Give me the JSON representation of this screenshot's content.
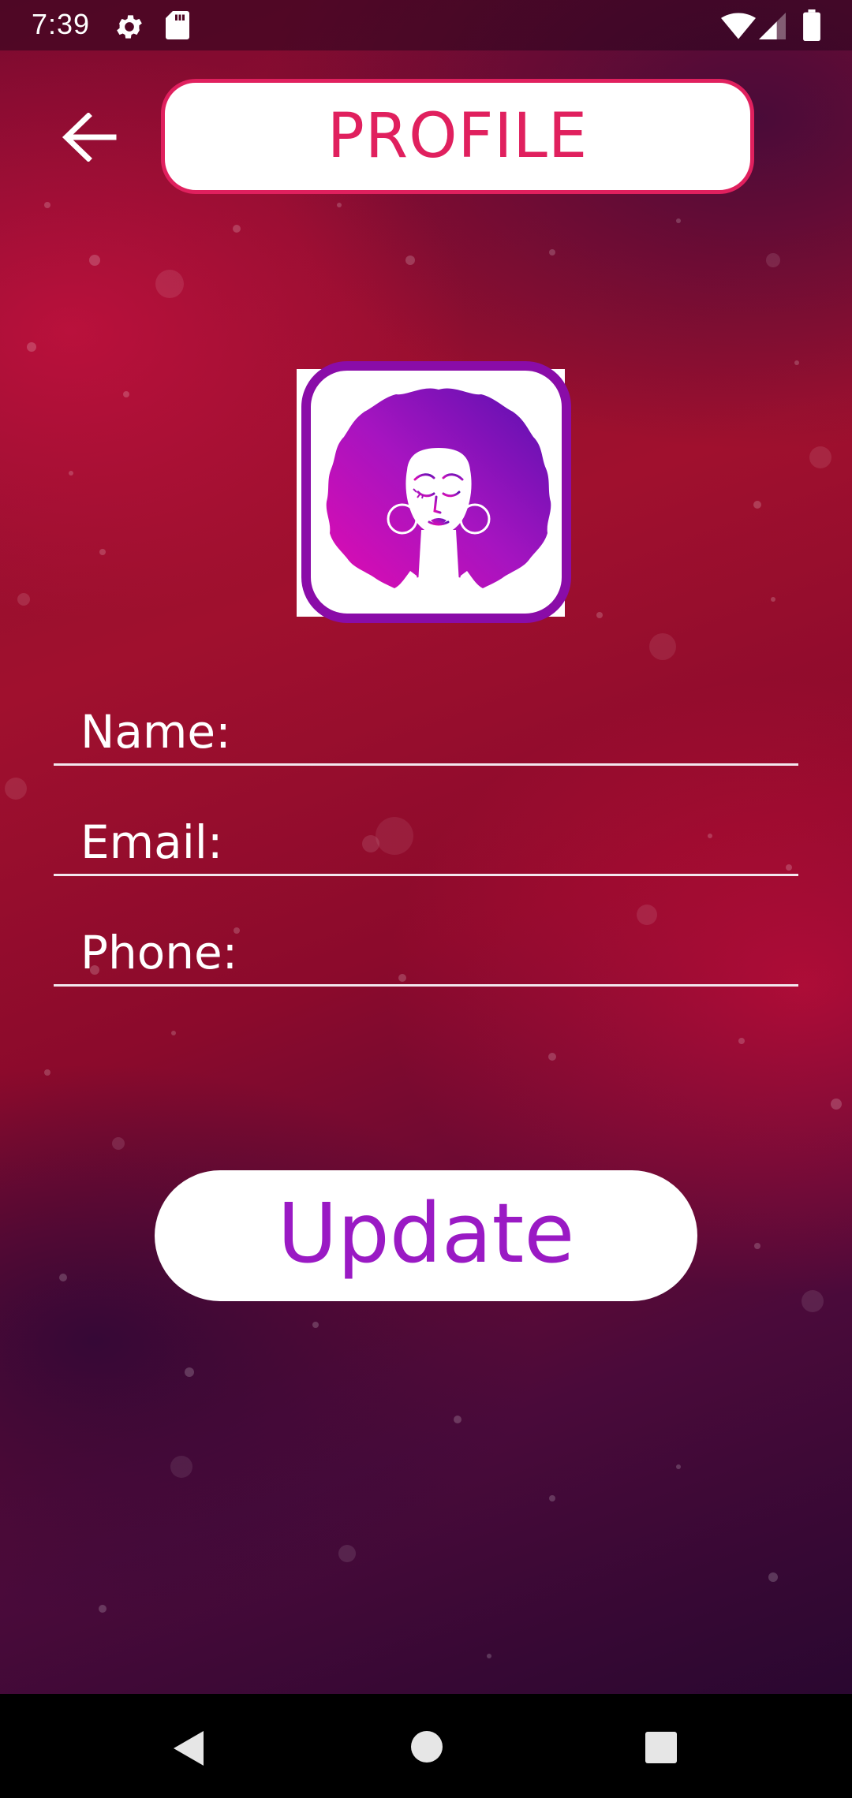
{
  "status_bar": {
    "time": "7:39",
    "icons": [
      "gear-icon",
      "sd-card-icon",
      "wifi-icon",
      "cell-signal-icon",
      "battery-icon"
    ]
  },
  "header": {
    "back_icon": "arrow-left-icon",
    "title": "PROFILE"
  },
  "avatar": {
    "icon": "afro-woman-avatar-icon"
  },
  "form": {
    "fields": [
      {
        "label": "Name:",
        "value": ""
      },
      {
        "label": "Email:",
        "value": ""
      },
      {
        "label": "Phone:",
        "value": ""
      }
    ],
    "update_label": "Update"
  },
  "nav_bar": {
    "icons": [
      "nav-back-icon",
      "nav-home-icon",
      "nav-recents-icon"
    ]
  },
  "colors": {
    "accent_pink": "#e0205e",
    "accent_purple": "#9a1ac4",
    "avatar_border": "#8a0ca8",
    "background_red": "#a0102e",
    "background_dark": "#2a0730"
  }
}
